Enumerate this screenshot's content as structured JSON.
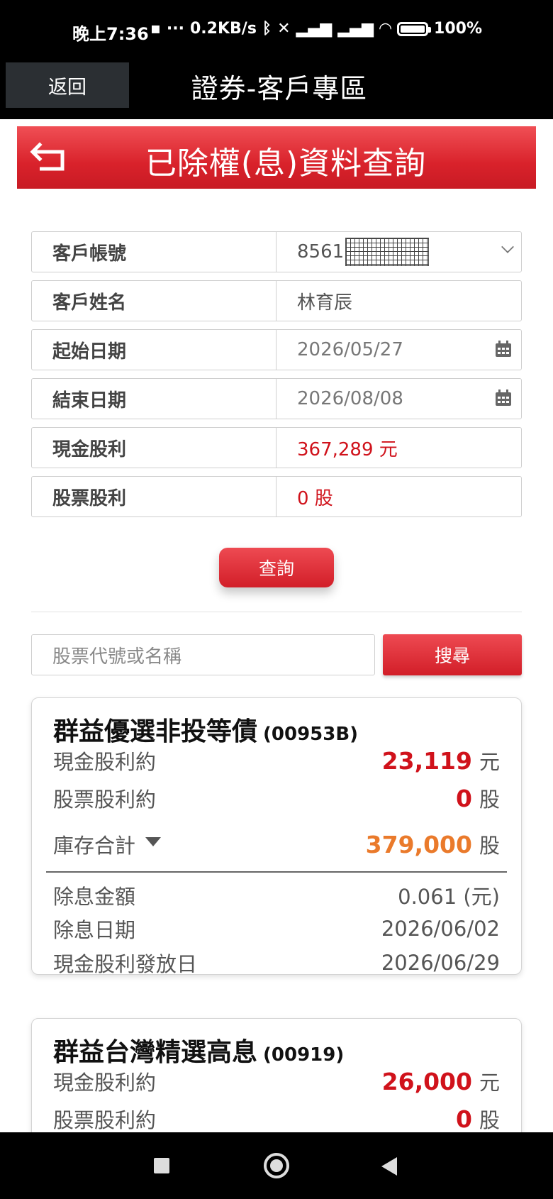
{
  "status_bar": {
    "time": "晚上7:36",
    "network_speed": "0.2KB/s",
    "battery": "100%",
    "icons": [
      "message-icon",
      "more-icon",
      "bluetooth-icon",
      "silent-icon",
      "signal-icon",
      "vowifi-icon",
      "signal-icon",
      "vowifi-icon",
      "wifi-icon",
      "battery-icon"
    ]
  },
  "header": {
    "back_label": "返回",
    "title": "證券-客戶專區"
  },
  "page": {
    "title": "已除權(息)資料查詢"
  },
  "form": {
    "account": {
      "label": "客戶帳號",
      "value": "8561"
    },
    "name": {
      "label": "客戶姓名",
      "value": "林育辰"
    },
    "start_date": {
      "label": "起始日期",
      "value": "2026/05/27"
    },
    "end_date": {
      "label": "結束日期",
      "value": "2026/08/08"
    },
    "cash_dividend": {
      "label": "現金股利",
      "value": "367,289 元"
    },
    "stock_dividend": {
      "label": "股票股利",
      "value": "0 股"
    }
  },
  "query_button": "查詢",
  "search": {
    "placeholder": "股票代號或名稱",
    "button": "搜尋"
  },
  "cards": [
    {
      "name": "群益優選非投等債",
      "code": "(00953B)",
      "cash_label": "現金股利約",
      "cash_value": "23,119",
      "cash_unit": "元",
      "stock_label": "股票股利約",
      "stock_value": "0",
      "stock_unit": "股",
      "holding_label": "庫存合計",
      "holding_value": "379,000",
      "holding_unit": "股",
      "ex_amount_label": "除息金額",
      "ex_amount_value": "0.061 (元)",
      "ex_date_label": "除息日期",
      "ex_date_value": "2026/06/02",
      "pay_date_label": "現金股利發放日",
      "pay_date_value": "2026/06/29"
    },
    {
      "name": "群益台灣精選高息",
      "code": "(00919)",
      "cash_label": "現金股利約",
      "cash_value": "26,000",
      "cash_unit": "元",
      "stock_label": "股票股利約",
      "stock_value": "0",
      "stock_unit": "股"
    }
  ],
  "colors": {
    "accent_red": "#d0121b",
    "orange": "#ea7a2b",
    "banner_red": "#e0262f"
  }
}
